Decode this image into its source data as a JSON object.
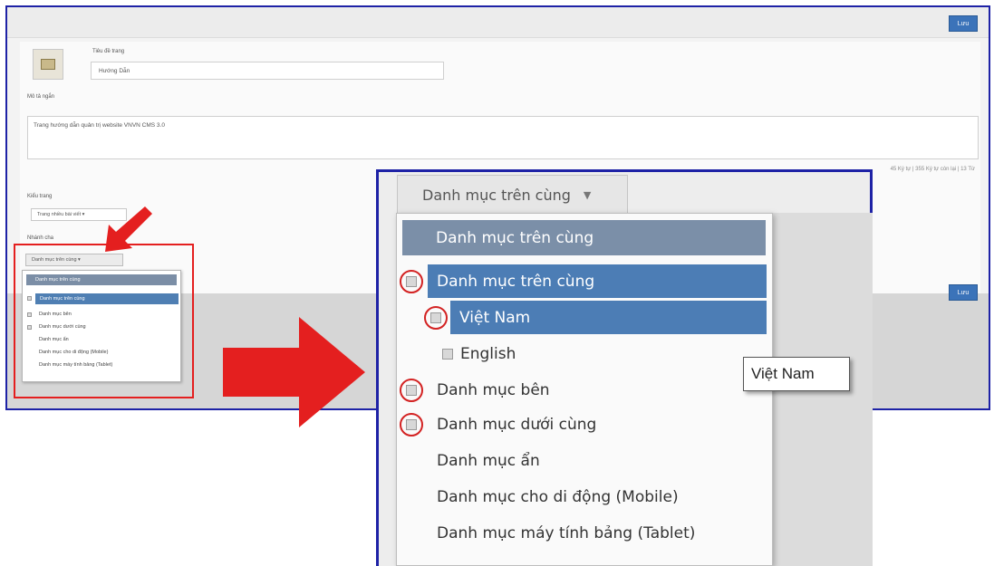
{
  "toolbar": {
    "save_label": "Lưu"
  },
  "form": {
    "title_label": "Tiêu đề trang",
    "title_value": "Hướng Dẫn",
    "desc_label": "Mô tả ngắn",
    "desc_value": "Trang hướng dẫn quản trị website VNVN CMS 3.0",
    "char_count": "45 Ký tự | 355 Ký tự còn lại | 13 Từ",
    "type_label": "Kiểu trang",
    "type_value": "Trang nhiều bài viết",
    "parent_label": "Nhánh cha"
  },
  "small_dropdown": {
    "button_label": "Danh mục trên cùng",
    "header": "Danh mục trên cùng",
    "items": [
      "Danh mục trên cùng",
      "Danh mục bên",
      "Danh mục dưới cùng",
      "Danh mục ẩn",
      "Danh mục cho di động (Mobile)",
      "Danh mục máy tính bảng (Tablet)"
    ]
  },
  "zoom_dropdown": {
    "button_label": "Danh mục trên cùng",
    "header": "Danh mục trên cùng",
    "items": [
      "Danh mục trên cùng",
      "Việt Nam",
      "English",
      "Danh mục bên",
      "Danh mục dưới cùng",
      "Danh mục ẩn",
      "Danh mục cho di động (Mobile)",
      "Danh mục máy tính bảng (Tablet)"
    ]
  },
  "tooltip": "Việt Nam",
  "icons": {
    "caret": "caret-down-icon",
    "expand": "expand-box-icon",
    "arrow": "red-arrow-icon"
  },
  "colors": {
    "frame_border": "#1e22a6",
    "selected_row": "#4c7db5",
    "header_row": "#7b8fa8",
    "save_button": "#3b73b9",
    "highlight_red": "#e41f1f"
  }
}
